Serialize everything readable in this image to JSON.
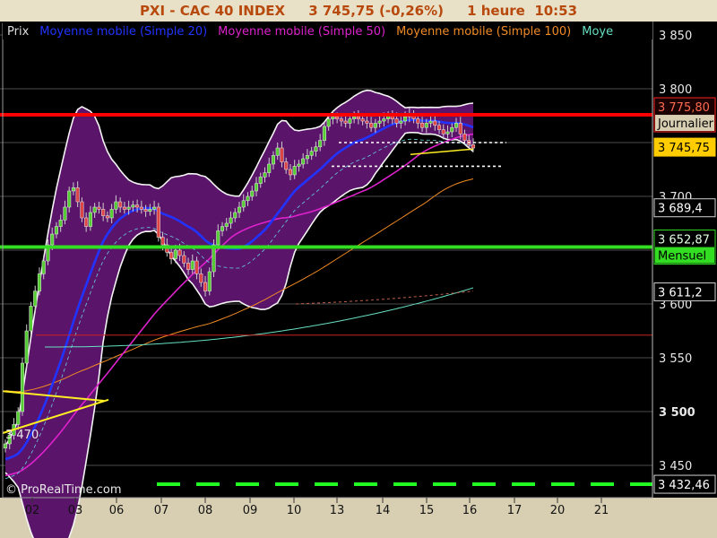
{
  "title": {
    "symbol": "PXI - CAC 40 INDEX",
    "price": "3 745,75 (-0,26%)",
    "timeframe": "1 heure",
    "time": "10:53"
  },
  "legend": [
    {
      "label": "Prix",
      "color": "#dcdcdc"
    },
    {
      "label": "Moyenne mobile (Simple 20)",
      "color": "#2233ff"
    },
    {
      "label": "Moyenne mobile (Simple 50)",
      "color": "#dd22cc"
    },
    {
      "label": "Moyenne mobile (Simple 100)",
      "color": "#f08a24"
    },
    {
      "label": "Moye",
      "color": "#66e0c0"
    }
  ],
  "watermark": "© ProRealTime.com",
  "low_label": "3 470",
  "colors": {
    "background": "#000000",
    "axis_bg": "#d8cfb3",
    "bollinger_fill": "#5a146a",
    "up_candle": "#55cc33",
    "down_candle": "#dd4444",
    "resistance": "#ff0000",
    "support": "#33dd22",
    "price_badge": "#ffcc00",
    "dashed_green": "#22ff22"
  },
  "chart_data": {
    "type": "line",
    "ylim": [
      3425,
      3860
    ],
    "x_ticks": [
      "02",
      "03",
      "06",
      "07",
      "08",
      "09",
      "10",
      "13",
      "14",
      "15",
      "16",
      "17",
      "20",
      "21"
    ],
    "y_ticks": [
      "3 850",
      "3 800",
      "3 700",
      "3 600",
      "3 550",
      "3 500",
      "3 450"
    ],
    "price_badges": [
      {
        "value": 3775.8,
        "label": "3 775,80",
        "sub": "Journalier",
        "style": "red"
      },
      {
        "value": 3745.75,
        "label": "3 745,75",
        "style": "yellow"
      },
      {
        "value": 3689.4,
        "label": "3 689,4",
        "style": "plain"
      },
      {
        "value": 3652.87,
        "label": "3 652,87",
        "sub": "Mensuel",
        "style": "green"
      },
      {
        "value": 3611.2,
        "label": "3 611,2",
        "style": "plain"
      },
      {
        "value": 3432.46,
        "label": "3 432,46",
        "style": "plain"
      }
    ],
    "horizontal_levels": [
      {
        "name": "daily-resistance",
        "value": 3775.8
      },
      {
        "name": "monthly-support",
        "value": 3652.87
      },
      {
        "name": "weekly-level",
        "value": 3432.46
      },
      {
        "name": "thin-red-level",
        "value": 3571
      }
    ],
    "closes": [
      3470,
      3478,
      3488,
      3500,
      3545,
      3575,
      3598,
      3612,
      3628,
      3640,
      3655,
      3665,
      3672,
      3678,
      3690,
      3705,
      3708,
      3695,
      3680,
      3672,
      3685,
      3690,
      3688,
      3682,
      3680,
      3688,
      3695,
      3690,
      3688,
      3690,
      3692,
      3690,
      3688,
      3686,
      3688,
      3690,
      3662,
      3655,
      3648,
      3642,
      3650,
      3645,
      3638,
      3632,
      3640,
      3628,
      3620,
      3612,
      3630,
      3655,
      3668,
      3672,
      3675,
      3680,
      3685,
      3690,
      3696,
      3700,
      3705,
      3712,
      3718,
      3722,
      3730,
      3738,
      3745,
      3732,
      3725,
      3720,
      3728,
      3730,
      3735,
      3738,
      3742,
      3746,
      3752,
      3765,
      3772,
      3774,
      3772,
      3770,
      3768,
      3772,
      3774,
      3772,
      3770,
      3768,
      3764,
      3768,
      3770,
      3772,
      3775,
      3772,
      3768,
      3770,
      3774,
      3776,
      3772,
      3768,
      3764,
      3768,
      3770,
      3766,
      3762,
      3758,
      3760,
      3764,
      3768,
      3758,
      3752,
      3748,
      3745
    ]
  }
}
